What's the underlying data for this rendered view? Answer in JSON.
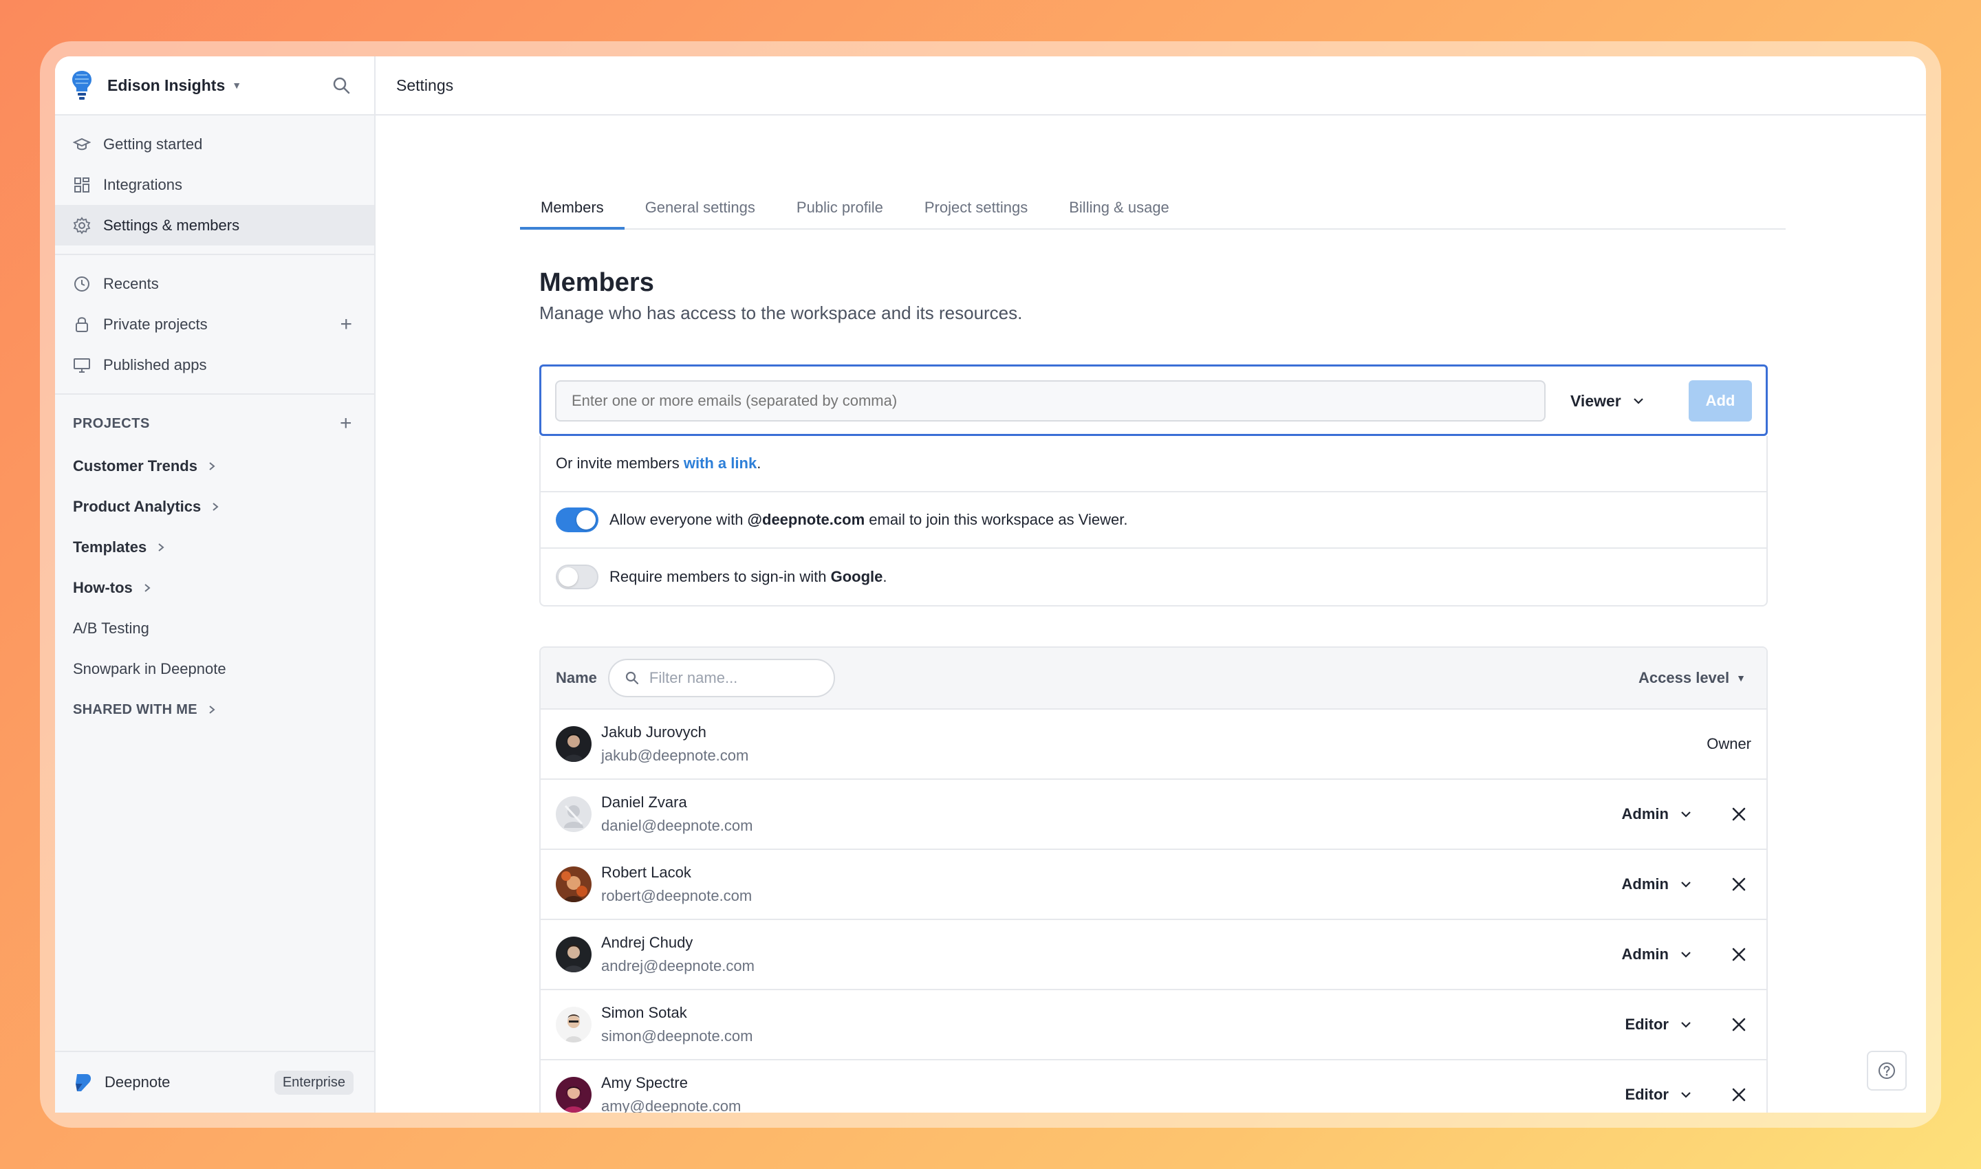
{
  "workspace": {
    "name": "Edison Insights"
  },
  "sidebar": {
    "top_items": [
      {
        "label": "Getting started",
        "icon": "graduation-cap-icon"
      },
      {
        "label": "Integrations",
        "icon": "grid-icon"
      },
      {
        "label": "Settings & members",
        "icon": "gear-icon",
        "active": true
      }
    ],
    "mid_items": [
      {
        "label": "Recents",
        "icon": "clock-icon"
      },
      {
        "label": "Private projects",
        "icon": "lock-icon"
      },
      {
        "label": "Published apps",
        "icon": "monitor-icon"
      }
    ],
    "projects_heading": "PROJECTS",
    "projects": [
      {
        "label": "Customer Trends"
      },
      {
        "label": "Product Analytics"
      },
      {
        "label": "Templates"
      },
      {
        "label": "How-tos"
      },
      {
        "label": "A/B Testing"
      },
      {
        "label": "Snowpark in Deepnote"
      }
    ],
    "shared_heading": "SHARED WITH ME",
    "footer": {
      "brand": "Deepnote",
      "plan": "Enterprise"
    }
  },
  "header": {
    "title": "Settings"
  },
  "tabs": [
    {
      "label": "Members",
      "active": true
    },
    {
      "label": "General settings"
    },
    {
      "label": "Public profile"
    },
    {
      "label": "Project settings"
    },
    {
      "label": "Billing & usage"
    }
  ],
  "members_page": {
    "title": "Members",
    "subtitle": "Manage who has access to the workspace and its resources.",
    "invite": {
      "placeholder": "Enter one or more emails (separated by comma)",
      "role": "Viewer",
      "add_label": "Add"
    },
    "link_prefix": "Or invite members ",
    "link_text": "with a link",
    "link_suffix": ".",
    "domain_toggle": {
      "enabled": true,
      "prefix": "Allow everyone with ",
      "domain": "@deepnote.com",
      "suffix": " email to join this workspace as Viewer."
    },
    "google_toggle": {
      "enabled": false,
      "prefix": "Require members to sign-in with ",
      "provider": "Google",
      "suffix": "."
    },
    "table": {
      "name_header": "Name",
      "filter_placeholder": "Filter name...",
      "access_header": "Access level",
      "rows": [
        {
          "name": "Jakub Jurovych",
          "email": "jakub@deepnote.com",
          "role": "Owner"
        },
        {
          "name": "Daniel Zvara",
          "email": "daniel@deepnote.com",
          "role": "Admin"
        },
        {
          "name": "Robert Lacok",
          "email": "robert@deepnote.com",
          "role": "Admin"
        },
        {
          "name": "Andrej Chudy",
          "email": "andrej@deepnote.com",
          "role": "Admin"
        },
        {
          "name": "Simon Sotak",
          "email": "simon@deepnote.com",
          "role": "Editor"
        },
        {
          "name": "Amy Spectre",
          "email": "amy@deepnote.com",
          "role": "Editor"
        }
      ]
    }
  },
  "colors": {
    "accent": "#2f80e0",
    "active_tab_underline": "#3b82d6",
    "add_button_disabled": "#a8cdf4",
    "link": "#2d7fd8"
  }
}
